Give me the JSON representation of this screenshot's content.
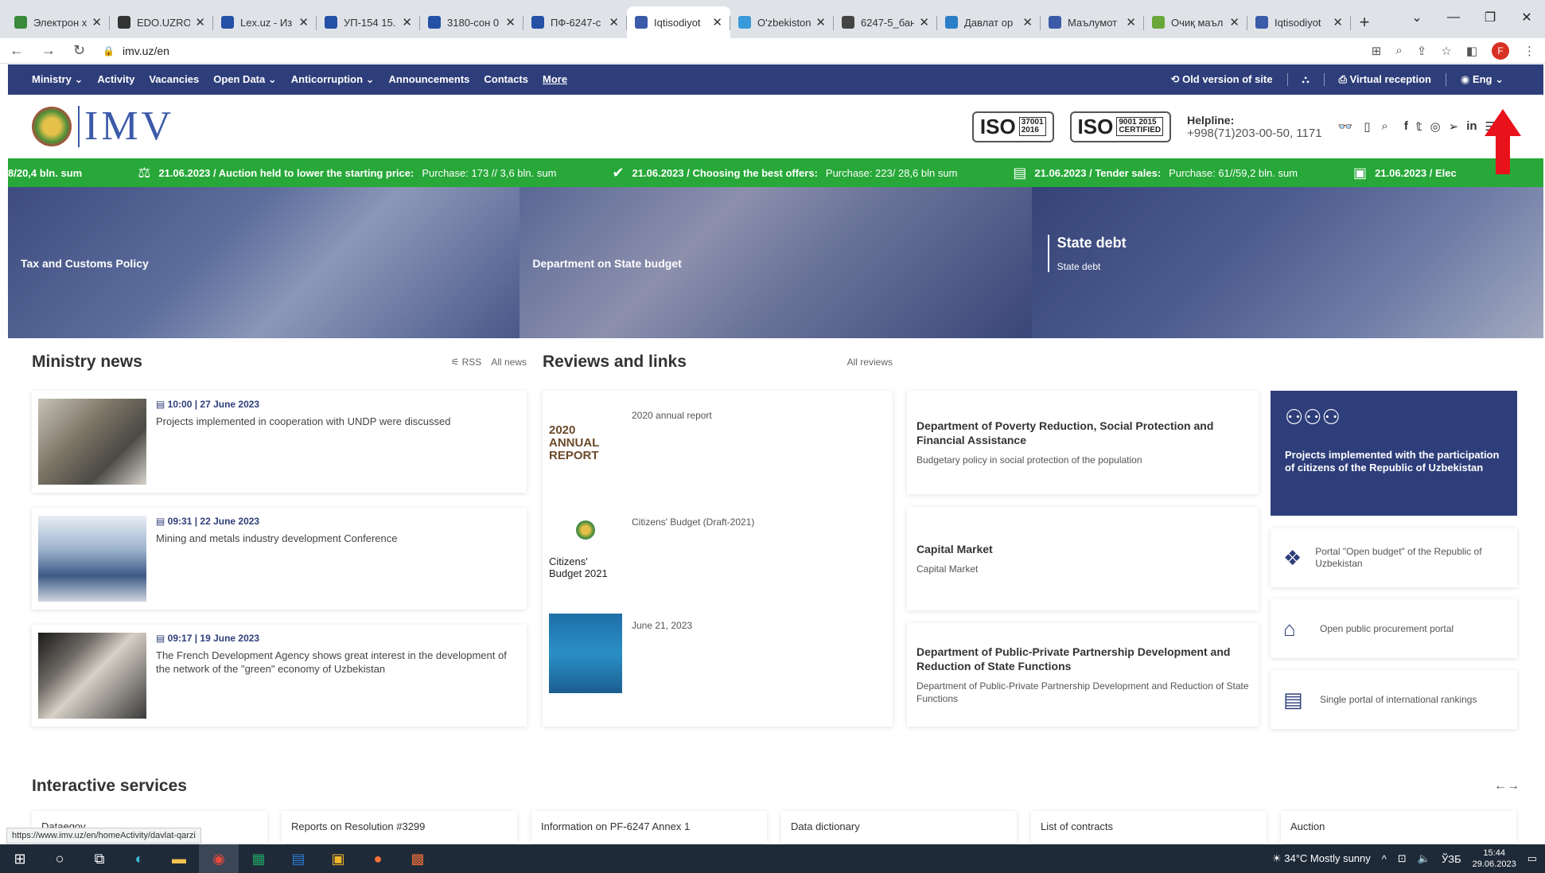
{
  "browser": {
    "tabs": [
      {
        "title": "Электрон ху",
        "color": "#3a8a3a"
      },
      {
        "title": "EDO.UZRO.U",
        "color": "#333333"
      },
      {
        "title": "Lex.uz - Из",
        "color": "#2450a6"
      },
      {
        "title": "УП-154 15.",
        "color": "#2450a6"
      },
      {
        "title": "3180-сон 0",
        "color": "#2450a6"
      },
      {
        "title": "ПФ-6247-с",
        "color": "#2450a6"
      },
      {
        "title": "Iqtisodiyot",
        "color": "#3b5aa8",
        "active": true
      },
      {
        "title": "O'zbekiston",
        "color": "#3a9ad9"
      },
      {
        "title": "6247-5_бан",
        "color": "#444444"
      },
      {
        "title": "Давлат ор",
        "color": "#2a7fc8"
      },
      {
        "title": "Маълумот",
        "color": "#3b5aa8"
      },
      {
        "title": "Очиқ маъл",
        "color": "#6aa73a"
      },
      {
        "title": "Iqtisodiyot",
        "color": "#3b5aa8"
      }
    ],
    "new_tab": "+",
    "url": "imv.uz/en",
    "profile_initial": "F",
    "status_url": "https://www.imv.uz/en/homeActivity/davlat-qarzi"
  },
  "site": {
    "nav": {
      "items": [
        "Ministry ⌄",
        "Activity",
        "Vacancies",
        "Open Data ⌄",
        "Anticorruption ⌄",
        "Announcements",
        "Contacts"
      ],
      "more": "More",
      "old_version": "Old version of site",
      "virtual_reception": "Virtual reception",
      "lang": "Eng ⌄"
    },
    "logo_text": "IMV",
    "iso1": {
      "label": "ISO",
      "code_top": "37001",
      "code_bottom": "2016"
    },
    "iso2": {
      "label": "ISO",
      "code_top": "9001 2015",
      "code_bottom": "CERTIFIED"
    },
    "helpline": {
      "label": "Helpline:",
      "number": "+998(71)203-00-50, 1171"
    },
    "ticker": [
      {
        "date": "",
        "text": "8/20,4 bln. sum",
        "val": ""
      },
      {
        "date": "21.06.2023 / Auction held to lower the starting price:",
        "val": "Purchase: 173 // 3,6 bln. sum"
      },
      {
        "date": "21.06.2023 / Choosing the best offers:",
        "val": "Purchase: 223/ 28,6 bln sum"
      },
      {
        "date": "21.06.2023 / Tender sales:",
        "val": "Purchase: 61//59,2 bln. sum"
      },
      {
        "date": "21.06.2023 / Elec",
        "val": ""
      }
    ],
    "banners": [
      {
        "label": "Tax and Customs Policy"
      },
      {
        "label": "Department on State budget"
      },
      {
        "label": "State debt",
        "sub": "State debt"
      }
    ],
    "news": {
      "title": "Ministry news",
      "rss": "RSS",
      "all": "All news",
      "items": [
        {
          "date": "10:00 | 27 June 2023",
          "title": "Projects implemented in cooperation with UNDP were discussed"
        },
        {
          "date": "09:31 | 22 June 2023",
          "title": "Mining and metals industry development Conference"
        },
        {
          "date": "09:17 | 19 June 2023",
          "title": "The French Development Agency shows great interest in the development of the network of the \"green\" economy of Uzbekistan"
        }
      ]
    },
    "reviews": {
      "title": "Reviews and links",
      "all": "All reviews",
      "items": [
        {
          "title": "2020 annual report",
          "thumb": "2020 ANNUAL REPORT"
        },
        {
          "title": "Citizens' Budget (Draft-2021)",
          "thumb": "Citizens' Budget 2021"
        },
        {
          "title": "June 21, 2023",
          "thumb": ""
        }
      ]
    },
    "departments": [
      {
        "title": "Department of Poverty Reduction, Social Protection and Financial Assistance",
        "sub": "Budgetary policy in social protection of the population"
      },
      {
        "title": "Capital Market",
        "sub": "Capital Market"
      },
      {
        "title": "Department of Public-Private Partnership Development and Reduction of State Functions",
        "sub": "Department of Public-Private Partnership Development and Reduction of State Functions"
      }
    ],
    "portals": {
      "hero": "Projects implemented with the participation of citizens of the Republic of Uzbekistan",
      "items": [
        {
          "title": "Portal \"Open budget\" of the Republic of Uzbekistan"
        },
        {
          "title": "Open public procurement portal"
        },
        {
          "title": "Single portal of international rankings"
        }
      ]
    },
    "services": {
      "title": "Interactive services",
      "arrows": "←→",
      "items": [
        "Dataegov",
        "Reports on Resolution #3299",
        "Information on PF-6247 Annex 1",
        "Data dictionary",
        "List of contracts",
        "Auction"
      ]
    }
  },
  "taskbar": {
    "weather": "34°C  Mostly sunny",
    "lang": "ЎЗБ",
    "time": "15:44",
    "date": "29.06.2023"
  }
}
